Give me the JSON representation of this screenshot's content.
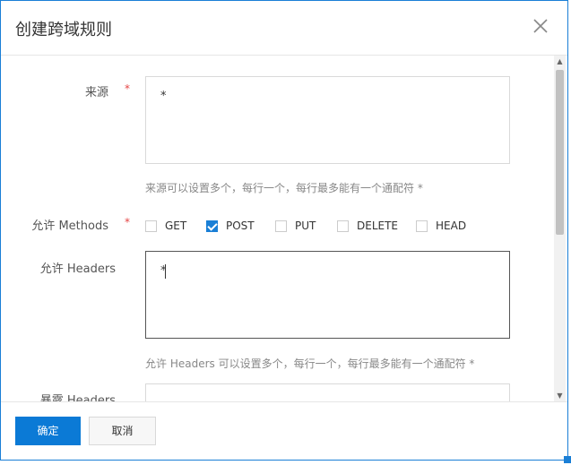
{
  "dialog": {
    "title": "创建跨域规则",
    "close_icon": "close-icon"
  },
  "form": {
    "origin": {
      "label": "来源",
      "required_mark": "*",
      "value": "*",
      "hint": "来源可以设置多个，每行一个，每行最多能有一个通配符 *"
    },
    "methods": {
      "label": "允许 Methods",
      "required_mark": "*",
      "options": [
        {
          "label": "GET",
          "checked": false
        },
        {
          "label": "POST",
          "checked": true
        },
        {
          "label": "PUT",
          "checked": false
        },
        {
          "label": "DELETE",
          "checked": false
        },
        {
          "label": "HEAD",
          "checked": false
        }
      ]
    },
    "headers": {
      "label": "允许 Headers",
      "value": "*",
      "hint": "允许 Headers 可以设置多个，每行一个，每行最多能有一个通配符 *"
    },
    "expose_headers": {
      "label": "暴露 Headers"
    }
  },
  "footer": {
    "confirm_label": "确定",
    "cancel_label": "取消"
  },
  "colors": {
    "accent": "#0b7ad6",
    "required": "#e54545"
  }
}
